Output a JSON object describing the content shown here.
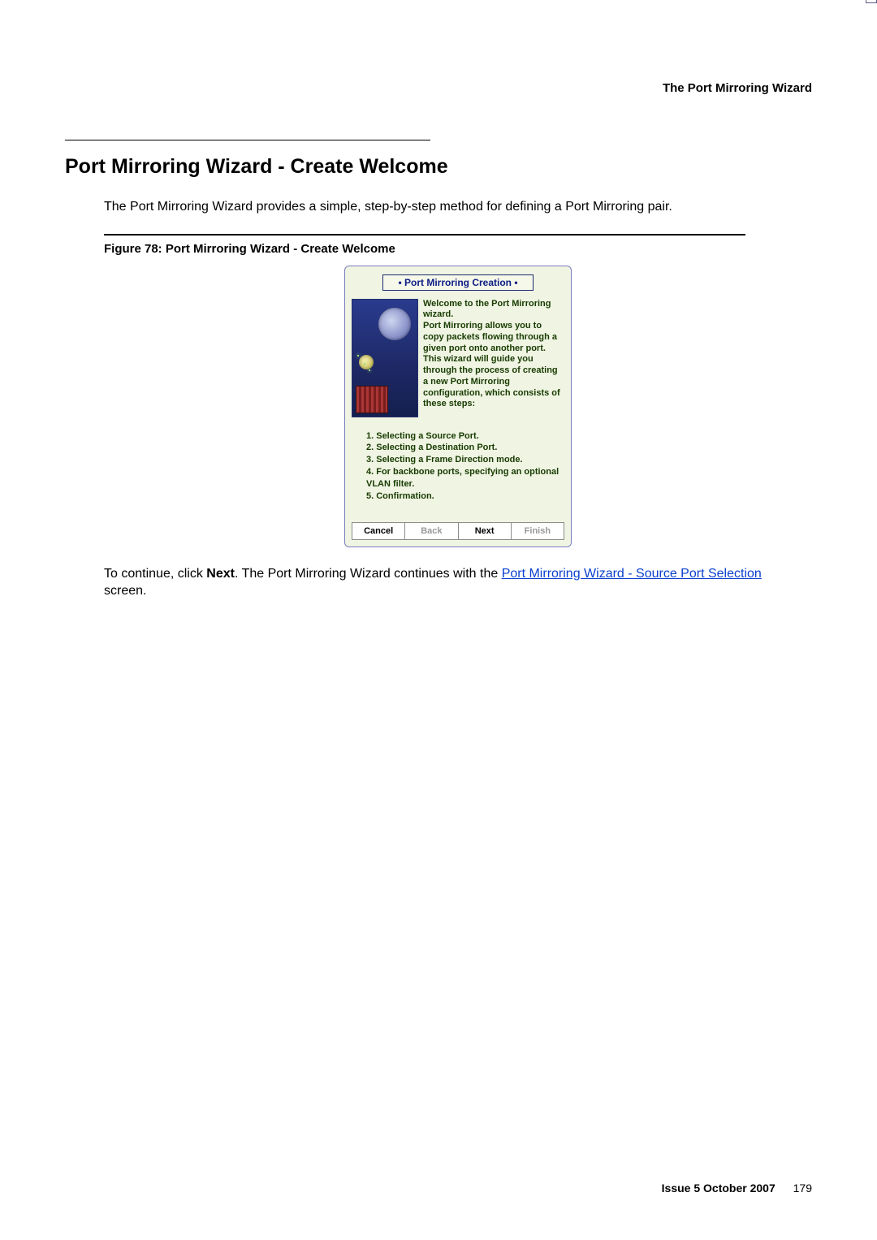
{
  "header": {
    "title": "The Port Mirroring Wizard"
  },
  "section": {
    "title": "Port Mirroring Wizard - Create Welcome",
    "intro": "The Port Mirroring Wizard provides a simple, step-by-step method for defining a Port Mirroring pair."
  },
  "figure": {
    "caption": "Figure 78: Port Mirroring Wizard - Create Welcome"
  },
  "dialog": {
    "banner": "• Port Mirroring Creation •",
    "close_glyph": "×",
    "welcome_text": "Welcome to the Port Mirroring wizard.\nPort Mirroring allows you to copy packets flowing through a given port onto another port.\nThis wizard will guide you through the process of creating a new Port Mirroring configuration, which consists of these steps:",
    "steps": [
      "1. Selecting a Source Port.",
      "2. Selecting a Destination Port.",
      "3. Selecting a Frame Direction mode.",
      "4. For backbone ports, specifying an optional VLAN filter.",
      "5. Confirmation."
    ],
    "buttons": {
      "cancel": "Cancel",
      "back": "Back",
      "next": "Next",
      "finish": "Finish"
    }
  },
  "after": {
    "pre": "To continue, click ",
    "bold": "Next",
    "mid": ". The Port Mirroring Wizard continues with the ",
    "link": "Port Mirroring Wizard - Source Port Selection",
    "post": " screen."
  },
  "footer": {
    "issue": "Issue 5   October 2007",
    "page": "179"
  }
}
